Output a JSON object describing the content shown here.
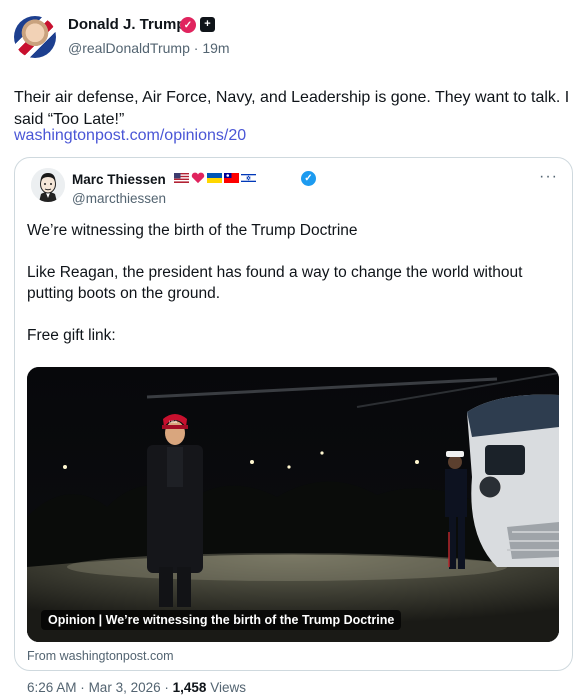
{
  "post": {
    "author_name": "Donald J. Trump",
    "handle": "@realDonaldTrump",
    "separator": "·",
    "time_ago": "19m",
    "text": "Their air defense, Air Force, Navy, and Leadership is gone. They want to talk. I said “Too Late!”",
    "link": "washingtonpost.com/opinions/20",
    "verified_icon": "verified-badge-icon",
    "affiliate_icon": "affiliate-badge-icon"
  },
  "quote": {
    "author_name": "Marc Thiessen",
    "handle": "@marcthiessen",
    "flags": [
      "us-flag-icon",
      "red-heart-icon",
      "ukraine-flag-icon",
      "taiwan-flag-icon",
      "israel-flag-icon"
    ],
    "more_label": "···",
    "lines": [
      "We’re witnessing the birth of the Trump Doctrine",
      "Like Reagan, the president has found a way to change the world without putting boots on the ground.",
      "Free gift link:"
    ],
    "media_caption": "Opinion | We’re witnessing the birth of the Trump Doctrine",
    "from_label": "From washingtonpost.com"
  },
  "meta": {
    "time": "6:26 AM",
    "date": "Mar 3, 2026",
    "views_count": "1,458",
    "views_label": "Views",
    "separator": "·"
  },
  "colors": {
    "link": "#4a56d6",
    "secondary_text": "#536471",
    "verified_blue": "#1d9bf0",
    "verified_pink": "#e0245e",
    "border": "#cfd9de"
  }
}
